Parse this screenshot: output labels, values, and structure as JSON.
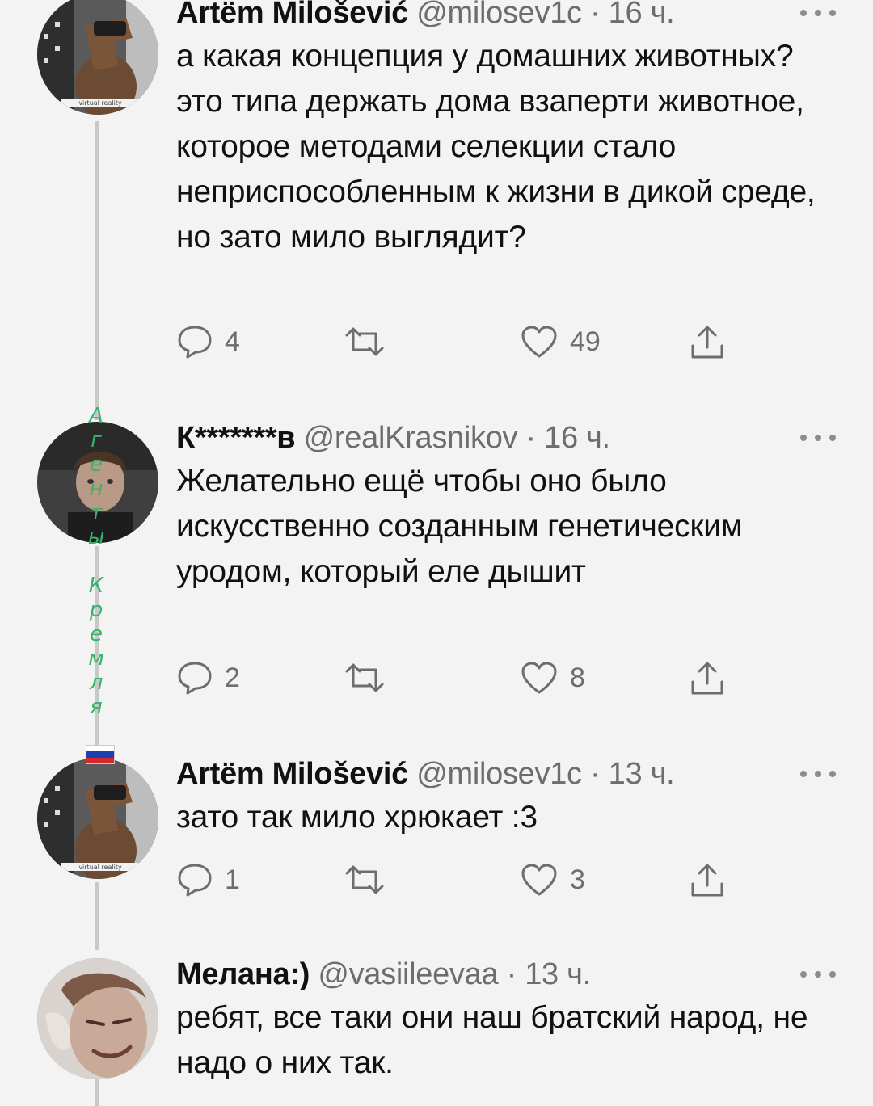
{
  "tweets": [
    {
      "name": "Artëm Milošević",
      "handle": "@milosev1c",
      "time": "16 ч.",
      "avatar_label": "virtual reality",
      "text": "а какая концепция у домашних животных? это типа держать дома взаперти животное, которое методами селекции стало неприспособленным к жизни в дикой среде, но зато мило выглядит?",
      "replies": "4",
      "retweets": "",
      "likes": "49"
    },
    {
      "name": "К*******в",
      "handle": "@realKrasnikov",
      "time": "16 ч.",
      "text": "Желательно ещё чтобы оно было искусственно созданным генетическим уродом, который еле дышит",
      "replies": "2",
      "retweets": "",
      "likes": "8"
    },
    {
      "name": "Artëm Milošević",
      "handle": "@milosev1c",
      "time": "13 ч.",
      "avatar_label": "virtual reality",
      "text": "зато так мило хрюкает :3",
      "replies": "1",
      "retweets": "",
      "likes": "3"
    },
    {
      "name": "Мелана:)",
      "handle": "@vasiileevaa",
      "time": "13 ч.",
      "text": "ребят, все таки они наш братский народ, не надо о них так."
    }
  ],
  "overlay": {
    "letters": [
      "А",
      "г",
      "е",
      "н",
      "т",
      "ы",
      "К",
      "р",
      "е",
      "м",
      "л",
      "я"
    ]
  },
  "icons": {
    "reply": "reply-icon",
    "retweet": "retweet-icon",
    "like": "heart-icon",
    "share": "share-icon",
    "more": "more-icon",
    "flag": "russian-flag-icon"
  },
  "colors": {
    "background": "#f3f3f3",
    "text": "#111111",
    "muted": "#6d6d6d",
    "overlay_text": "#38b36a"
  }
}
